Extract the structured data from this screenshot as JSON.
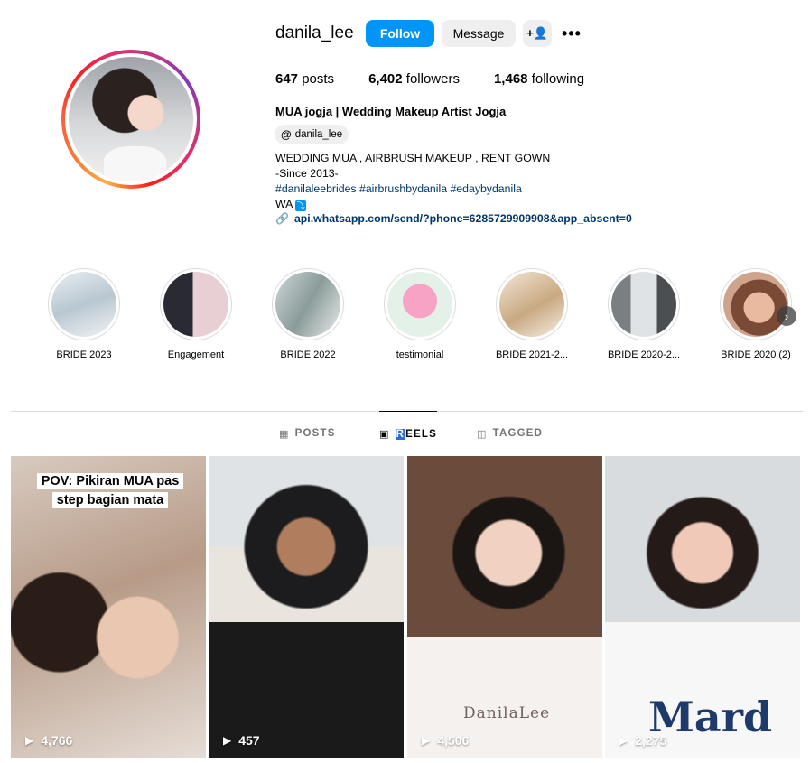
{
  "profile": {
    "username": "danila_lee",
    "buttons": {
      "follow": "Follow",
      "message": "Message",
      "add_user_icon": "add-user-icon",
      "more_icon": "more-icon"
    },
    "stats": {
      "posts": "647",
      "posts_label": "posts",
      "followers": "6,402",
      "followers_label": "followers",
      "following": "1,468",
      "following_label": "following"
    },
    "full_name": "MUA jogja | Wedding Makeup Artist Jogja",
    "threads_handle": "danila_lee",
    "bio": {
      "line1": "WEDDING MUA , AIRBRUSH MAKEUP , RENT GOWN",
      "line2": "-Since 2013-",
      "tags": "#danilaleebrides #airbrushbydanila #edaybydanila",
      "line4": "WA"
    },
    "link": "api.whatsapp.com/send/?phone=6285729909908&app_absent=0"
  },
  "highlights": [
    {
      "label": "BRIDE 2023"
    },
    {
      "label": "Engagement"
    },
    {
      "label": "BRIDE 2022"
    },
    {
      "label": "testimonial"
    },
    {
      "label": "BRIDE 2021-2..."
    },
    {
      "label": "BRIDE 2020-2..."
    },
    {
      "label": "BRIDE 2020 (2)"
    }
  ],
  "tabs": {
    "posts": "POSTS",
    "reels_first": "R",
    "reels_rest": "EELS",
    "tagged": "TAGGED"
  },
  "reels": [
    {
      "views": "4,766",
      "caption_line1": "POV: Pikiran MUA pas",
      "caption_line2": "step bagian mata"
    },
    {
      "views": "457"
    },
    {
      "views": "4,506",
      "watermark": "DanilaLee"
    },
    {
      "views": "2,275",
      "shirt_text": "Mard"
    }
  ],
  "colors": {
    "follow_button": "#0095f6",
    "link": "#00376b",
    "secondary_button": "#efefef"
  }
}
